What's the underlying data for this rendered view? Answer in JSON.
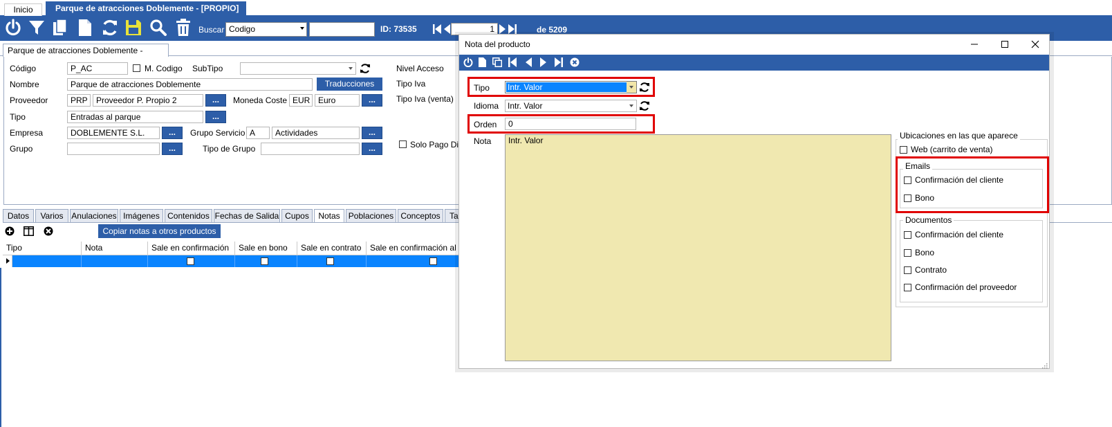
{
  "window_tabs": {
    "home": "Inicio",
    "active": "Parque de atracciones Doblemente - [PROPIO]"
  },
  "toolbar": {
    "search_label": "Buscar",
    "search_field": "Codigo",
    "search_value": "",
    "id_label": "ID: 73535",
    "record_number": "1",
    "record_total": "de 5209"
  },
  "doc_tab": "Parque de atracciones Doblemente - [PROPIO]",
  "form": {
    "codigo_label": "Código",
    "codigo_value": "P_AC",
    "mcodigo_label": "M. Codigo",
    "subtipo_label": "SubTipo",
    "subtipo_value": "",
    "nivel_label": "Nivel Acceso",
    "nombre_label": "Nombre",
    "nombre_value": "Parque de atracciones Doblemente",
    "traducciones_label": "Traducciones",
    "tipoiva_label": "Tipo Iva",
    "proveedor_label": "Proveedor",
    "proveedor_code": "PRP",
    "proveedor_name": "Proveedor P. Propio 2",
    "moneda_label": "Moneda Coste",
    "moneda_code": "EUR",
    "moneda_name": "Euro",
    "tipoiva_venta_label": "Tipo Iva (venta)",
    "tipo_label": "Tipo",
    "tipo_value": "Entradas al parque",
    "empresa_label": "Empresa",
    "empresa_value": "DOBLEMENTE S.L.",
    "gruposervicio_label": "Grupo Servicio",
    "gruposervicio_code": "A",
    "gruposervicio_name": "Actividades",
    "grupo_label": "Grupo",
    "grupo_value": "",
    "tipogrupo_label": "Tipo de Grupo",
    "tipogrupo_value": "",
    "solopago_label": "Solo Pago Direc",
    "dots": "..."
  },
  "detail_tabs": [
    "Datos",
    "Varios",
    "Anulaciones",
    "Imágenes",
    "Contenidos",
    "Fechas de Salida",
    "Cupos",
    "Notas",
    "Poblaciones",
    "Conceptos",
    "Ta"
  ],
  "notes_panel": {
    "copy_button": "Copiar notas a otros productos",
    "columns": [
      "Tipo",
      "Nota",
      "Sale en confirmación",
      "Sale en bono",
      "Sale en contrato",
      "Sale en confirmación al pro"
    ]
  },
  "dialog": {
    "title": "Nota del producto",
    "tipo_label": "Tipo",
    "tipo_value": "Intr. Valor",
    "idioma_label": "Idioma",
    "idioma_value": "Intr. Valor",
    "orden_label": "Orden",
    "orden_value": "0",
    "nota_label": "Nota",
    "nota_value": "Intr. Valor",
    "ubicaciones_title": "Ubicaciones en las que aparece",
    "web_label": "Web (carrito de venta)",
    "emails_title": "Emails",
    "emails_items": [
      "Confirmación del cliente",
      "Bono"
    ],
    "documentos_title": "Documentos",
    "documentos_items": [
      "Confirmación del cliente",
      "Bono",
      "Contrato",
      "Confirmación del proveedor"
    ]
  },
  "colors": {
    "accent": "#2d5ea8",
    "highlight": "#0a84ff",
    "note_bg": "#f0e8b0",
    "annotation": "#e00000"
  }
}
